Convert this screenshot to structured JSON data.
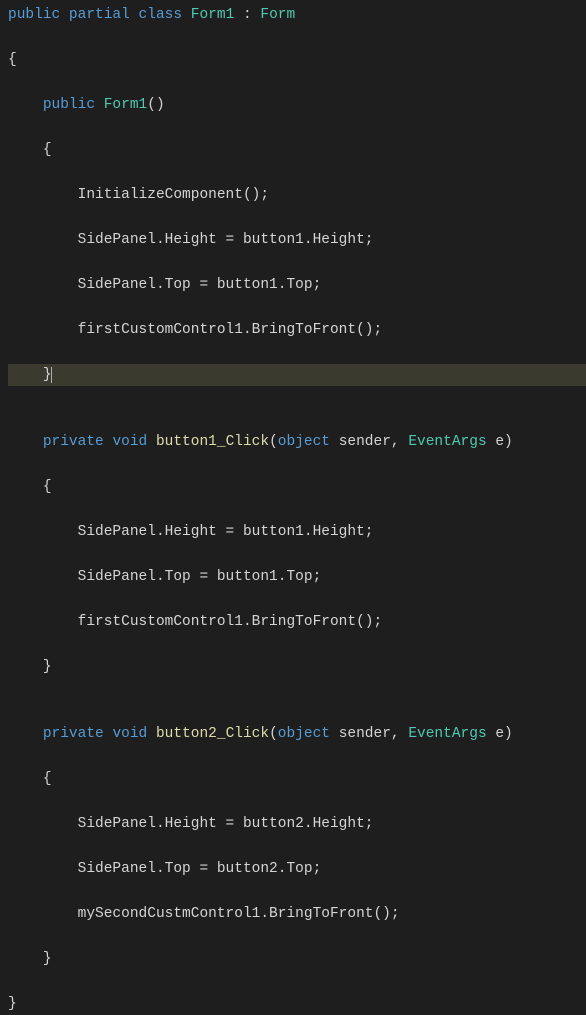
{
  "code": {
    "kw_public": "public",
    "kw_partial": "partial",
    "kw_class": "class",
    "classname_form1": "Form1",
    "colon": " : ",
    "classname_form": "Form",
    "kw_private": "private",
    "kw_void": "void",
    "kw_object": "object",
    "param_sender": " sender, ",
    "type_eventargs": "EventArgs",
    "param_e": " e)",
    "ctor_name": "Form1",
    "ctor_parens": "()",
    "method_button1_click": "button1_Click",
    "method_button2_click": "button2_Click",
    "open_paren": "(",
    "brace_open": "{",
    "brace_close": "}",
    "stmt_init": "InitializeComponent();",
    "stmt_sp_height_b1": "SidePanel.Height = button1.Height;",
    "stmt_sp_top_b1": "SidePanel.Top = button1.Top;",
    "stmt_first_btf": "firstCustomControl1.BringToFront();",
    "stmt_sp_height_b1_b": "SidePanel.Height = button1.Height;",
    "stmt_sp_top_b1_b": "SidePanel.Top = button1.Top;",
    "stmt_first_btf_b": "firstCustomControl1.BringToFront();",
    "stmt_sp_height_b2": "SidePanel.Height = button2.Height;",
    "stmt_sp_top_b2": "SidePanel.Top = button2.Top;",
    "stmt_second_btf": "mySecondCustmControl1.BringToFront();"
  }
}
